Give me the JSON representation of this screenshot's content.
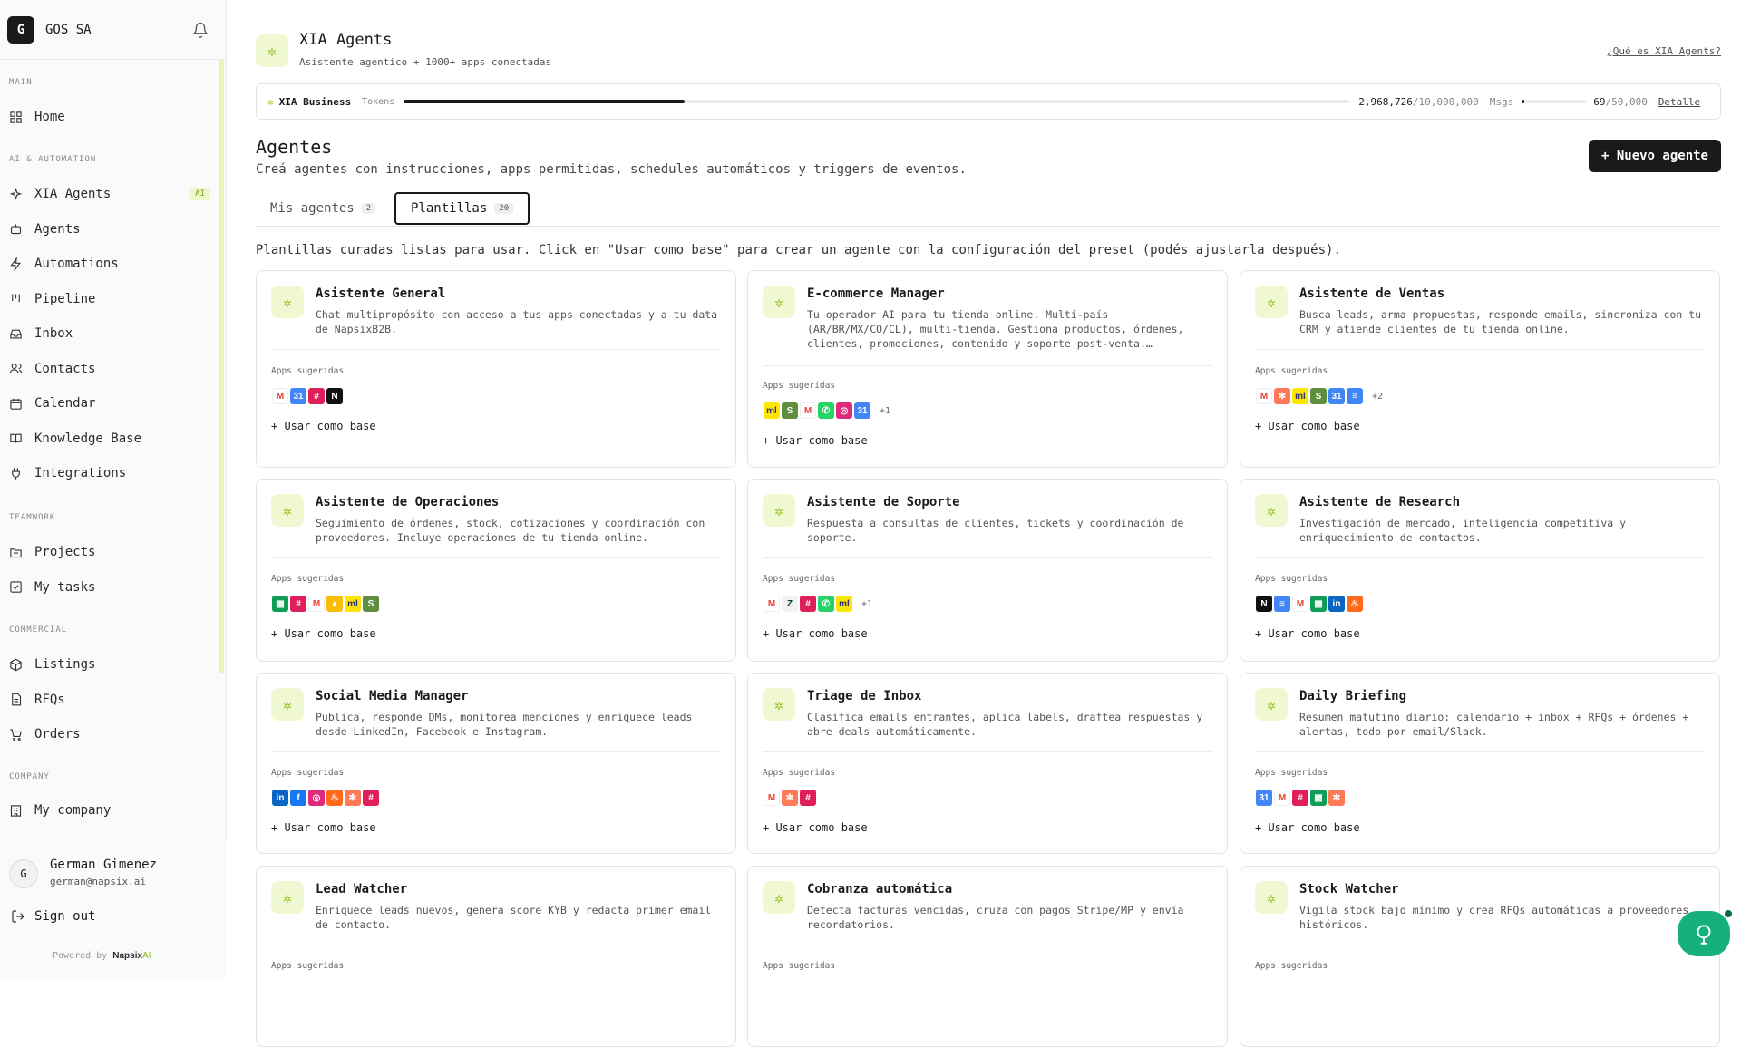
{
  "workspace": {
    "initial": "G",
    "name": "GOS SA"
  },
  "sidebar": {
    "sections": [
      {
        "title": "MAIN",
        "items": [
          {
            "label": "Home",
            "icon": "grid-icon"
          }
        ]
      },
      {
        "title": "AI & AUTOMATION",
        "items": [
          {
            "label": "XIA Agents",
            "icon": "sparkle-icon",
            "badge": "AI"
          },
          {
            "label": "Agents",
            "icon": "bot-icon"
          },
          {
            "label": "Automations",
            "icon": "bolt-icon"
          },
          {
            "label": "Pipeline",
            "icon": "kanban-icon"
          },
          {
            "label": "Inbox",
            "icon": "inbox-icon"
          },
          {
            "label": "Contacts",
            "icon": "users-icon"
          },
          {
            "label": "Calendar",
            "icon": "calendar-icon"
          },
          {
            "label": "Knowledge Base",
            "icon": "book-icon"
          },
          {
            "label": "Integrations",
            "icon": "plug-icon"
          }
        ]
      },
      {
        "title": "TEAMWORK",
        "items": [
          {
            "label": "Projects",
            "icon": "folder-icon"
          },
          {
            "label": "My tasks",
            "icon": "checkbox-icon"
          }
        ]
      },
      {
        "title": "COMMERCIAL",
        "items": [
          {
            "label": "Listings",
            "icon": "package-icon"
          },
          {
            "label": "RFQs",
            "icon": "file-icon"
          },
          {
            "label": "Orders",
            "icon": "cart-icon"
          }
        ]
      },
      {
        "title": "COMPANY",
        "items": [
          {
            "label": "My company",
            "icon": "building-icon"
          }
        ]
      }
    ]
  },
  "user": {
    "initial": "G",
    "name": "German Gimenez",
    "email": "german@napsix.ai",
    "signout": "Sign out",
    "powered": "Powered by",
    "brand": "Napsix",
    "brand_ai": "AI"
  },
  "header": {
    "title": "XIA Agents",
    "subtitle": "Asistente agentico + 1000+ apps conectadas",
    "link": "¿Qué es XIA Agents?"
  },
  "usage": {
    "plan": "XIA Business",
    "tokens_label": "Tokens",
    "tokens_used": "2,968,726",
    "tokens_total": "/10,000,000",
    "tokens_fraction": 0.2969,
    "msgs_label": "Msgs",
    "msgs_used": "69",
    "msgs_total": "/50,000",
    "msgs_fraction": 0.0014,
    "detail": "Detalle"
  },
  "page": {
    "title": "Agentes",
    "subtitle": "Creá agentes con instrucciones, apps permitidas, schedules automáticos y triggers de eventos.",
    "new_button": "+ Nuevo agente",
    "tabs": [
      {
        "label": "Mis agentes",
        "count": "2"
      },
      {
        "label": "Plantillas",
        "count": "20",
        "active": true
      }
    ],
    "intro": "Plantillas curadas listas para usar. Click en \"Usar como base\" para crear un agente con la configuración del preset (podés ajustarla después)."
  },
  "cards_common": {
    "apps_label": "Apps sugeridas",
    "use_label": "+ Usar como base"
  },
  "templates": [
    {
      "title": "Asistente General",
      "desc": "Chat multipropósito con acceso a tus apps conectadas y a tu data de NapsixB2B.",
      "apps": [
        "gmail",
        "gcal",
        "slack",
        "notion"
      ],
      "more": ""
    },
    {
      "title": "E-commerce Manager",
      "desc": "Tu operador AI para tu tienda online. Multi-país (AR/BR/MX/CO/CL), multi-tienda. Gestiona productos, órdenes, clientes, promociones, contenido y soporte post-venta.…",
      "apps": [
        "mercadolibre",
        "shopify",
        "gmail",
        "whatsapp",
        "instagram",
        "gcal"
      ],
      "more": "+1"
    },
    {
      "title": "Asistente de Ventas",
      "desc": "Busca leads, arma propuestas, responde emails, sincroniza con tu CRM y atiende clientes de tu tienda online.",
      "apps": [
        "gmail",
        "hubspot",
        "mercadolibre",
        "shopify",
        "gcal",
        "gdocs"
      ],
      "more": "+2"
    },
    {
      "title": "Asistente de Operaciones",
      "desc": "Seguimiento de órdenes, stock, cotizaciones y coordinación con proveedores. Incluye operaciones de tu tienda online.",
      "apps": [
        "gsheets",
        "slack",
        "gmail",
        "gdrive",
        "mercadolibre",
        "shopify"
      ],
      "more": ""
    },
    {
      "title": "Asistente de Soporte",
      "desc": "Respuesta a consultas de clientes, tickets y coordinación de soporte.",
      "apps": [
        "gmail",
        "zendesk",
        "slack",
        "whatsapp",
        "mercadolibre"
      ],
      "more": "+1"
    },
    {
      "title": "Asistente de Research",
      "desc": "Investigación de mercado, inteligencia competitiva y enriquecimiento de contactos.",
      "apps": [
        "notion",
        "gdocs",
        "gmail",
        "gsheets",
        "linkedin",
        "firecrawl"
      ],
      "more": ""
    },
    {
      "title": "Social Media Manager",
      "desc": "Publica, responde DMs, monitorea menciones y enriquece leads desde LinkedIn, Facebook e Instagram.",
      "apps": [
        "linkedin",
        "facebook",
        "instagram",
        "firecrawl",
        "hubspot",
        "slack"
      ],
      "more": ""
    },
    {
      "title": "Triage de Inbox",
      "desc": "Clasifica emails entrantes, aplica labels, draftea respuestas y abre deals automáticamente.",
      "apps": [
        "gmail",
        "hubspot",
        "slack"
      ],
      "more": ""
    },
    {
      "title": "Daily Briefing",
      "desc": "Resumen matutino diario: calendario + inbox + RFQs + órdenes + alertas, todo por email/Slack.",
      "apps": [
        "gcal",
        "gmail",
        "slack",
        "gsheets",
        "hubspot"
      ],
      "more": ""
    },
    {
      "title": "Lead Watcher",
      "desc": "Enriquece leads nuevos, genera score KYB y redacta primer email de contacto.",
      "apps": [],
      "more": ""
    },
    {
      "title": "Cobranza automática",
      "desc": "Detecta facturas vencidas, cruza con pagos Stripe/MP y envía recordatorios.",
      "apps": [],
      "more": ""
    },
    {
      "title": "Stock Watcher",
      "desc": "Vigila stock bajo mínimo y crea RFQs automáticas a proveedores históricos.",
      "apps": [],
      "more": ""
    }
  ],
  "app_styles": {
    "gmail": {
      "glyph": "M",
      "color": "#ea4335",
      "bg": "#ffffff"
    },
    "gcal": {
      "glyph": "31",
      "color": "#ffffff",
      "bg": "#4285f4"
    },
    "slack": {
      "glyph": "#",
      "color": "#ffffff",
      "bg": "#e01e5a"
    },
    "notion": {
      "glyph": "N",
      "color": "#ffffff",
      "bg": "#111111"
    },
    "mercadolibre": {
      "glyph": "ml",
      "color": "#2d3277",
      "bg": "#ffe600"
    },
    "shopify": {
      "glyph": "S",
      "color": "#ffffff",
      "bg": "#5e8e3e"
    },
    "whatsapp": {
      "glyph": "✆",
      "color": "#ffffff",
      "bg": "#25d366"
    },
    "instagram": {
      "glyph": "◎",
      "color": "#ffffff",
      "bg": "#dd2a7b"
    },
    "hubspot": {
      "glyph": "✻",
      "color": "#ffffff",
      "bg": "#ff7a59"
    },
    "gdocs": {
      "glyph": "≡",
      "color": "#ffffff",
      "bg": "#4285f4"
    },
    "gsheets": {
      "glyph": "▦",
      "color": "#ffffff",
      "bg": "#0f9d58"
    },
    "gdrive": {
      "glyph": "▲",
      "color": "#ffffff",
      "bg": "#fbbc04"
    },
    "zendesk": {
      "glyph": "Z",
      "color": "#03363d",
      "bg": "#f3f3f3"
    },
    "linkedin": {
      "glyph": "in",
      "color": "#ffffff",
      "bg": "#0a66c2"
    },
    "firecrawl": {
      "glyph": "♨",
      "color": "#ffffff",
      "bg": "#ff6b1a"
    },
    "facebook": {
      "glyph": "f",
      "color": "#ffffff",
      "bg": "#1877f2"
    }
  }
}
